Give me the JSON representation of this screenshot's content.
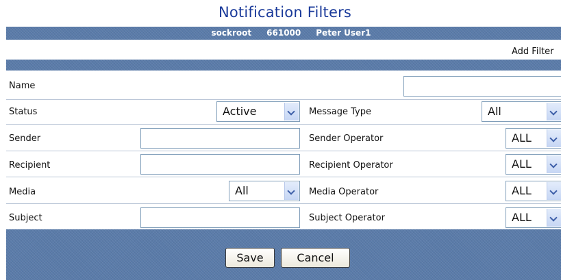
{
  "page_title": "Notification Filters",
  "user_bar": {
    "account": "sockroot",
    "id": "661000",
    "user_name": "Peter User1"
  },
  "actions": {
    "add_filter": "Add Filter"
  },
  "form": {
    "name": {
      "label": "Name",
      "value": ""
    },
    "status": {
      "label": "Status",
      "value": "Active"
    },
    "message_type": {
      "label": "Message Type",
      "value": "All"
    },
    "sender": {
      "label": "Sender",
      "value": ""
    },
    "sender_operator": {
      "label": "Sender Operator",
      "value": "ALL"
    },
    "recipient": {
      "label": "Recipient",
      "value": ""
    },
    "recipient_operator": {
      "label": "Recipient Operator",
      "value": "ALL"
    },
    "media": {
      "label": "Media",
      "value": "All"
    },
    "media_operator": {
      "label": "Media Operator",
      "value": "ALL"
    },
    "subject": {
      "label": "Subject",
      "value": ""
    },
    "subject_operator": {
      "label": "Subject Operator",
      "value": "ALL"
    }
  },
  "buttons": {
    "save": "Save",
    "cancel": "Cancel"
  },
  "icons": {
    "dropdown": "chevron-down-icon"
  },
  "colors": {
    "header_bar": "#5a7ba9",
    "title": "#1a3a9a"
  }
}
